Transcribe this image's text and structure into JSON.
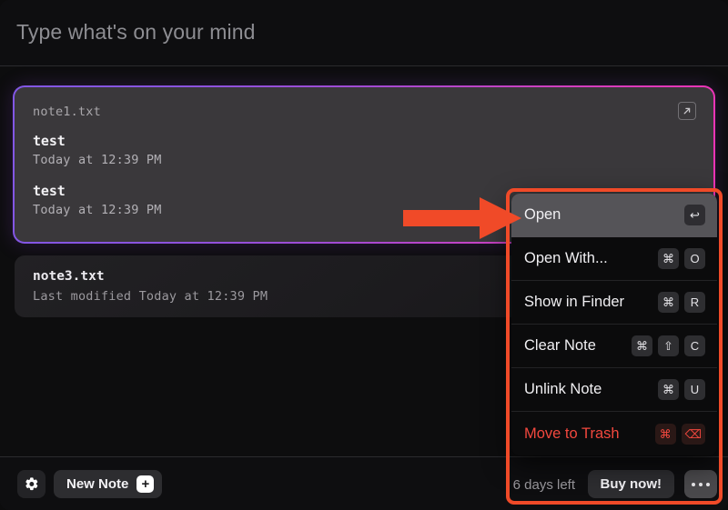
{
  "app": {
    "accent_purple": "#8257e5",
    "accent_magenta": "#f032b4",
    "annotation_color": "#f04a28",
    "danger_color": "#f2483e"
  },
  "header": {
    "placeholder": "Type what's on your mind",
    "value": ""
  },
  "active_note": {
    "filename": "note1.txt",
    "expand_icon": "open-in-new-icon",
    "entries": [
      {
        "title": "test",
        "timestamp": "Today at 12:39 PM"
      },
      {
        "title": "test",
        "timestamp": "Today at 12:39 PM"
      }
    ]
  },
  "notes": [
    {
      "filename": "note3.txt",
      "subtitle": "Last modified Today at 12:39 PM"
    }
  ],
  "context_menu": {
    "items": [
      {
        "label": "Open",
        "keys": [
          "↩"
        ],
        "highlighted": true,
        "danger": false
      },
      {
        "label": "Open With...",
        "keys": [
          "⌘",
          "O"
        ],
        "highlighted": false,
        "danger": false
      },
      {
        "label": "Show in Finder",
        "keys": [
          "⌘",
          "R"
        ],
        "highlighted": false,
        "danger": false
      },
      {
        "label": "Clear Note",
        "keys": [
          "⌘",
          "⇧",
          "C"
        ],
        "highlighted": false,
        "danger": false
      },
      {
        "label": "Unlink Note",
        "keys": [
          "⌘",
          "U"
        ],
        "highlighted": false,
        "danger": false
      },
      {
        "label": "Move to Trash",
        "keys": [
          "⌘",
          "⌫"
        ],
        "highlighted": false,
        "danger": true
      }
    ]
  },
  "footer": {
    "settings_icon": "gear-icon",
    "new_note_label": "New Note",
    "new_note_icon": "plus-icon",
    "trial_text": "6 days left",
    "buy_label": "Buy now!",
    "more_icon": "ellipsis-icon"
  }
}
